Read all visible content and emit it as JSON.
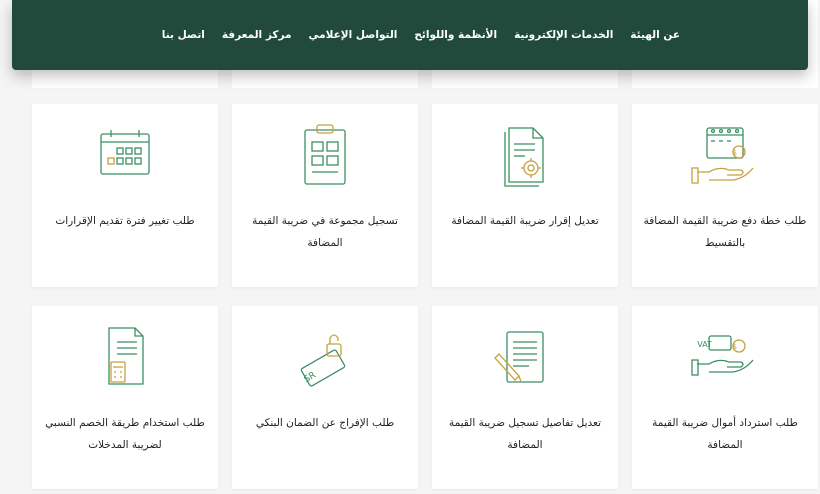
{
  "colors": {
    "nav_bg": "#214a3d",
    "accent": "#c8a03c",
    "icon_green": "#3c8f65",
    "page_bg": "#f4f5f4"
  },
  "navbar": {
    "items": [
      "عن الهيئة",
      "الخدمات الإلكترونية",
      "الأنظمة واللوائح",
      "التواصل الإعلامي",
      "مركز المعرفة",
      "اتصل بنا"
    ]
  },
  "services": [
    {
      "title": "طلب خطة دفع ضريبة القيمة المضافة بالتقسيط",
      "icon": "installment-calendar-hand-icon"
    },
    {
      "title": "تعديل إقرار ضريبة القيمة المضافة",
      "icon": "document-gear-icon"
    },
    {
      "title": "تسجيل مجموعة في ضريبة القيمة المضافة",
      "icon": "clipboard-grid-icon"
    },
    {
      "title": "طلب تغيير فترة تقديم الإقرارات",
      "icon": "calendar-icon"
    },
    {
      "title": "طلب استرداد أموال ضريبة القيمة المضافة",
      "icon": "vat-refund-hand-icon"
    },
    {
      "title": "تعديل تفاصيل تسجيل ضريبة القيمة المضافة",
      "icon": "document-pencil-icon"
    },
    {
      "title": "طلب الإفراج عن الضمان البنكي",
      "icon": "banknote-lock-icon"
    },
    {
      "title": "طلب استخدام طريقة الخصم النسبي لضريبة المدخلات",
      "icon": "document-calculator-icon"
    }
  ]
}
